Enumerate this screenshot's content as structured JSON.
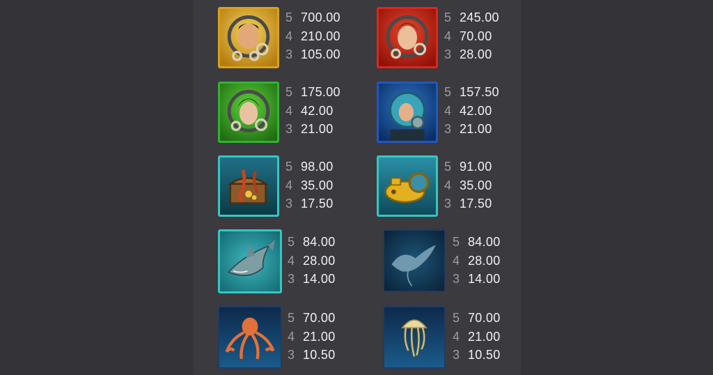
{
  "paytable": {
    "symbols": [
      {
        "name": "Male Diver",
        "icon": "male-diver-icon",
        "frame_color": "#d9a21b",
        "pays": [
          {
            "count": "5",
            "value": "700.00"
          },
          {
            "count": "4",
            "value": "210.00"
          },
          {
            "count": "3",
            "value": "105.00"
          }
        ]
      },
      {
        "name": "Female Diver Red",
        "icon": "female-diver-red-icon",
        "frame_color": "#e0261c",
        "pays": [
          {
            "count": "5",
            "value": "245.00"
          },
          {
            "count": "4",
            "value": "70.00"
          },
          {
            "count": "3",
            "value": "28.00"
          }
        ]
      },
      {
        "name": "Female Diver Green",
        "icon": "female-diver-green-icon",
        "frame_color": "#2fb531",
        "pays": [
          {
            "count": "5",
            "value": "175.00"
          },
          {
            "count": "4",
            "value": "42.00"
          },
          {
            "count": "3",
            "value": "21.00"
          }
        ]
      },
      {
        "name": "Deep Sea Diver",
        "icon": "deep-sea-diver-icon",
        "frame_color": "#2257c2",
        "pays": [
          {
            "count": "5",
            "value": "157.50"
          },
          {
            "count": "4",
            "value": "42.00"
          },
          {
            "count": "3",
            "value": "21.00"
          }
        ]
      },
      {
        "name": "Treasure Chest",
        "icon": "treasure-chest-icon",
        "frame_color": "#35c7c4",
        "pays": [
          {
            "count": "5",
            "value": "98.00"
          },
          {
            "count": "4",
            "value": "35.00"
          },
          {
            "count": "3",
            "value": "17.50"
          }
        ]
      },
      {
        "name": "Submarine",
        "icon": "submarine-icon",
        "frame_color": "#35c7c4",
        "pays": [
          {
            "count": "5",
            "value": "91.00"
          },
          {
            "count": "4",
            "value": "35.00"
          },
          {
            "count": "3",
            "value": "17.50"
          }
        ]
      },
      {
        "name": "Shark",
        "icon": "shark-icon",
        "frame_color": "#35c7c4",
        "pays": [
          {
            "count": "5",
            "value": "84.00"
          },
          {
            "count": "4",
            "value": "28.00"
          },
          {
            "count": "3",
            "value": "14.00"
          }
        ]
      },
      {
        "name": "Manta Ray",
        "icon": "manta-ray-icon",
        "frame_color": "#1f3b63",
        "pays": [
          {
            "count": "5",
            "value": "84.00"
          },
          {
            "count": "4",
            "value": "28.00"
          },
          {
            "count": "3",
            "value": "14.00"
          }
        ]
      },
      {
        "name": "Octopus",
        "icon": "octopus-icon",
        "frame_color": "#1f3b63",
        "pays": [
          {
            "count": "5",
            "value": "70.00"
          },
          {
            "count": "4",
            "value": "21.00"
          },
          {
            "count": "3",
            "value": "10.50"
          }
        ]
      },
      {
        "name": "Jellyfish",
        "icon": "jellyfish-icon",
        "frame_color": "#1f3b63",
        "pays": [
          {
            "count": "5",
            "value": "70.00"
          },
          {
            "count": "4",
            "value": "21.00"
          },
          {
            "count": "3",
            "value": "10.50"
          }
        ]
      }
    ]
  }
}
